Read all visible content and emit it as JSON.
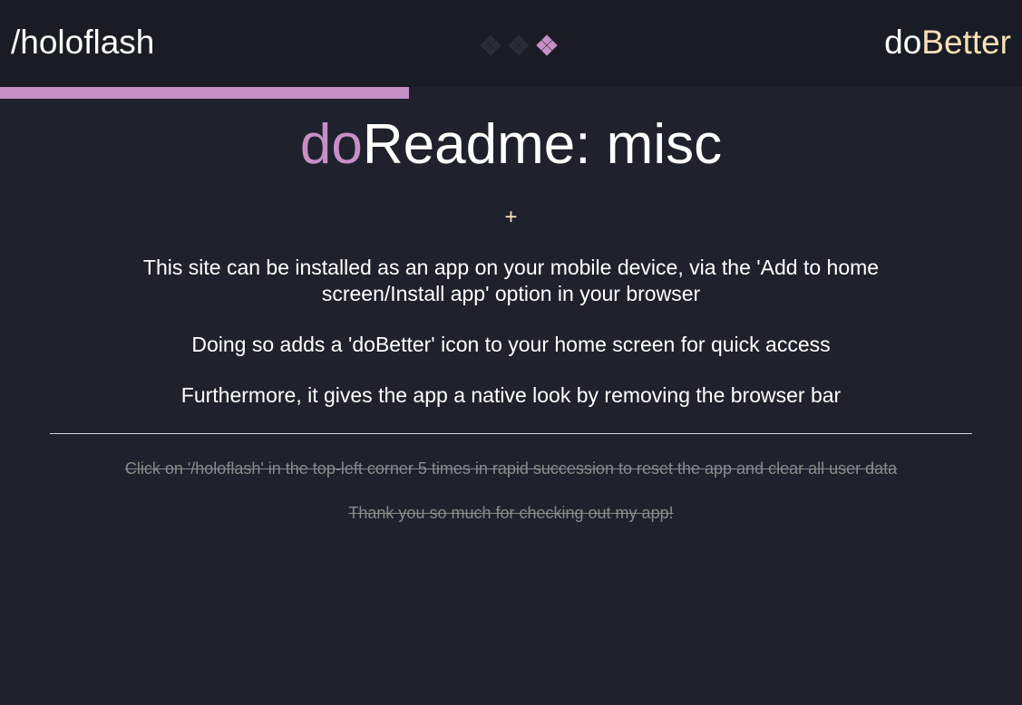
{
  "header": {
    "left_title": "/holoflash",
    "right_title_prefix": "do",
    "right_title_suffix": "Better",
    "step_indicator": {
      "total": 3,
      "active": 3,
      "inactive_color": "#2a2d38",
      "active_color": "#c68fc6"
    }
  },
  "progress": {
    "fraction": 0.4,
    "color": "#c68fc6"
  },
  "page": {
    "title_prefix": "do",
    "title_rest": "Readme: misc",
    "add_symbol": "+",
    "paragraphs": [
      "This site can be installed as an app on your mobile device, via the 'Add to home screen/Install app' option in your browser",
      "Doing so adds a 'doBetter' icon to your home screen for quick access",
      "Furthermore, it gives the app a native look by removing the browser bar"
    ],
    "footer_notes": [
      "Click on '/holoflash' in the top-left corner 5 times in rapid succession to reset the app and clear all user data",
      "Thank you so much for checking out my app!"
    ]
  },
  "colors": {
    "background": "#1f222d",
    "header_background": "#1a1c25",
    "accent_purple": "#c68fc6",
    "accent_cream": "#f9e0b7",
    "muted_text": "#8a8a8a"
  }
}
